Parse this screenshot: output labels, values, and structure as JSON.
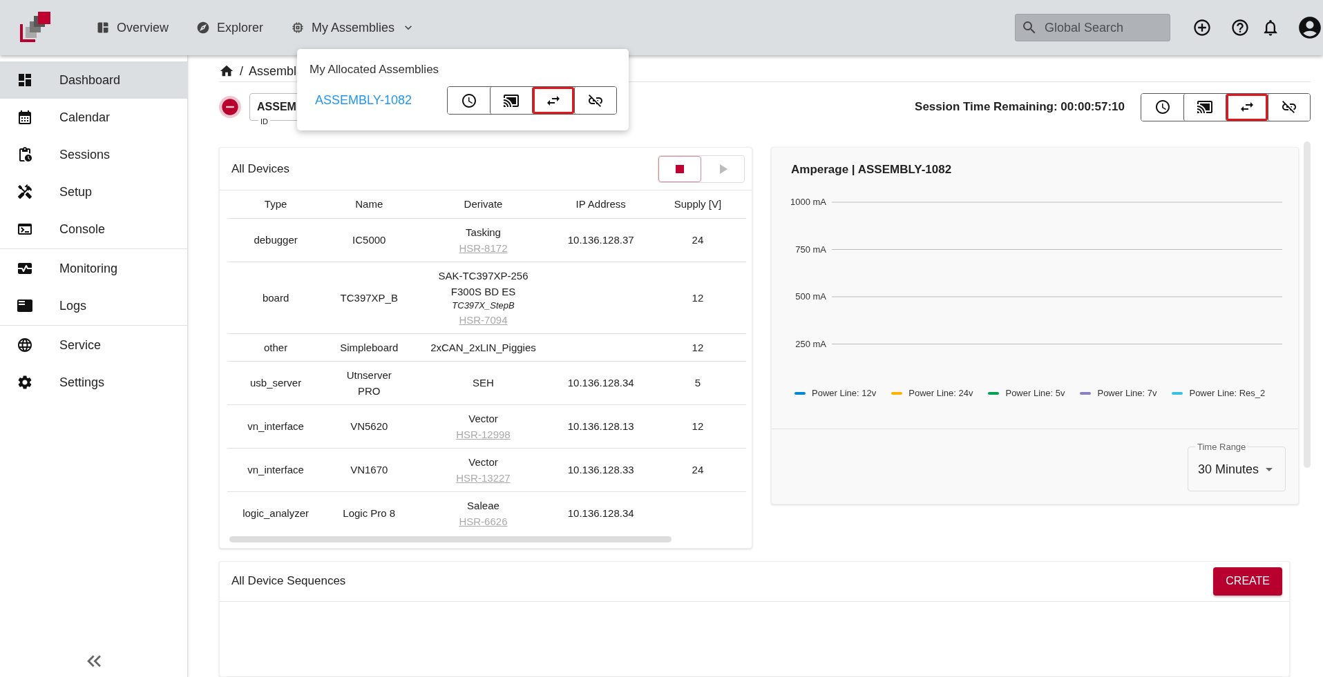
{
  "top_bar": {
    "nav": [
      {
        "label": "Overview",
        "kind": "overview"
      },
      {
        "label": "Explorer",
        "kind": "explorer"
      },
      {
        "label": "My Assemblies",
        "kind": "assemblies",
        "expanded": true
      }
    ],
    "search": {
      "placeholder": "Global Search"
    }
  },
  "sidebar": {
    "sections": [
      {
        "items": [
          {
            "label": "Dashboard",
            "kind": "dashboard",
            "selected": true
          },
          {
            "label": "Calendar",
            "kind": "calendar",
            "selected": false
          },
          {
            "label": "Sessions",
            "kind": "sessions",
            "selected": false
          },
          {
            "label": "Setup",
            "kind": "setup",
            "selected": false
          },
          {
            "label": "Console",
            "kind": "console",
            "selected": false
          }
        ]
      },
      {
        "items": [
          {
            "label": "Monitoring",
            "kind": "monitoring",
            "selected": false
          },
          {
            "label": "Logs",
            "kind": "logs",
            "selected": false
          }
        ]
      },
      {
        "items": [
          {
            "label": "Service",
            "kind": "service",
            "selected": false
          },
          {
            "label": "Settings",
            "kind": "settings",
            "selected": false
          }
        ]
      }
    ]
  },
  "breadcrumb": {
    "separator": "/",
    "current": "Assembl"
  },
  "assembly_field": {
    "label": "ID",
    "value": "ASSEM"
  },
  "session": {
    "text": "Session Time Remaining: 00:00:57:10"
  },
  "action_buttons": [
    {
      "kind": "schedule",
      "highlighted": false
    },
    {
      "kind": "cast",
      "highlighted": false
    },
    {
      "kind": "swap",
      "highlighted": true
    },
    {
      "kind": "unlink",
      "highlighted": false
    }
  ],
  "popup": {
    "title": "My Allocated Assemblies",
    "assemblies": [
      {
        "name": "ASSEMBLY-1082",
        "actions": [
          {
            "kind": "schedule",
            "highlighted": false
          },
          {
            "kind": "cast",
            "highlighted": false
          },
          {
            "kind": "swap",
            "highlighted": true
          },
          {
            "kind": "unlink",
            "highlighted": false
          }
        ]
      }
    ]
  },
  "devices": {
    "title": "All Devices",
    "controls": [
      {
        "kind": "stop",
        "active": true
      },
      {
        "kind": "play",
        "active": false
      }
    ],
    "columns": [
      "Type",
      "Name",
      "Derivate",
      "IP Address",
      "Supply [V]"
    ],
    "rows": [
      {
        "type": "debugger",
        "name": "IC5000",
        "derivate": "Tasking",
        "ticket": "HSR-8172",
        "ip": "10.136.128.37",
        "supply": "24"
      },
      {
        "type": "board",
        "name": "TC397XP_B",
        "derivate": "SAK-TC397XP-256 F300S BD ES",
        "variant": "TC397X_StepB",
        "ticket": "HSR-7094",
        "supply": "12"
      },
      {
        "type": "other",
        "name": "Simpleboard",
        "derivate": "2xCAN_2xLIN_Piggies",
        "supply": "12"
      },
      {
        "type": "usb_server",
        "name": "Utnserver PRO",
        "derivate": "SEH",
        "ip": "10.136.128.34",
        "supply": "5"
      },
      {
        "type": "vn_interface",
        "name": "VN5620",
        "derivate": "Vector",
        "ticket": "HSR-12998",
        "ip": "10.136.128.13",
        "supply": "12"
      },
      {
        "type": "vn_interface",
        "name": "VN1670",
        "derivate": "Vector",
        "ticket": "HSR-13227",
        "ip": "10.136.128.33",
        "supply": "24"
      },
      {
        "type": "logic_analyzer",
        "name": "Logic Pro 8",
        "derivate": "Saleae",
        "ticket": "HSR-6626",
        "ip": "10.136.128.34"
      }
    ]
  },
  "chart": {
    "title": "Amperage | ASSEMBLY-1082",
    "chart_data": {
      "type": "line",
      "grid": true,
      "ylim": [
        250,
        1000
      ],
      "yticks": [
        {
          "value": 250,
          "label": "250 mA"
        },
        {
          "value": 500,
          "label": "500 mA"
        },
        {
          "value": 750,
          "label": "750 mA"
        },
        {
          "value": 1000,
          "label": "1000 mA"
        }
      ],
      "series": [
        {
          "name": "Power Line: 12v",
          "color": "#0288d1"
        },
        {
          "name": "Power Line: 24v",
          "color": "#ffb300"
        },
        {
          "name": "Power Line: 5v",
          "color": "#00a152"
        },
        {
          "name": "Power Line: 7v",
          "color": "#8c7fc8"
        },
        {
          "name": "Power Line: Res_2",
          "color": "#3cc0e0"
        }
      ]
    },
    "time_range": {
      "label": "Time Range",
      "value": "30 Minutes"
    }
  },
  "sequences": {
    "title": "All Device Sequences",
    "create_button": "CREATE"
  }
}
